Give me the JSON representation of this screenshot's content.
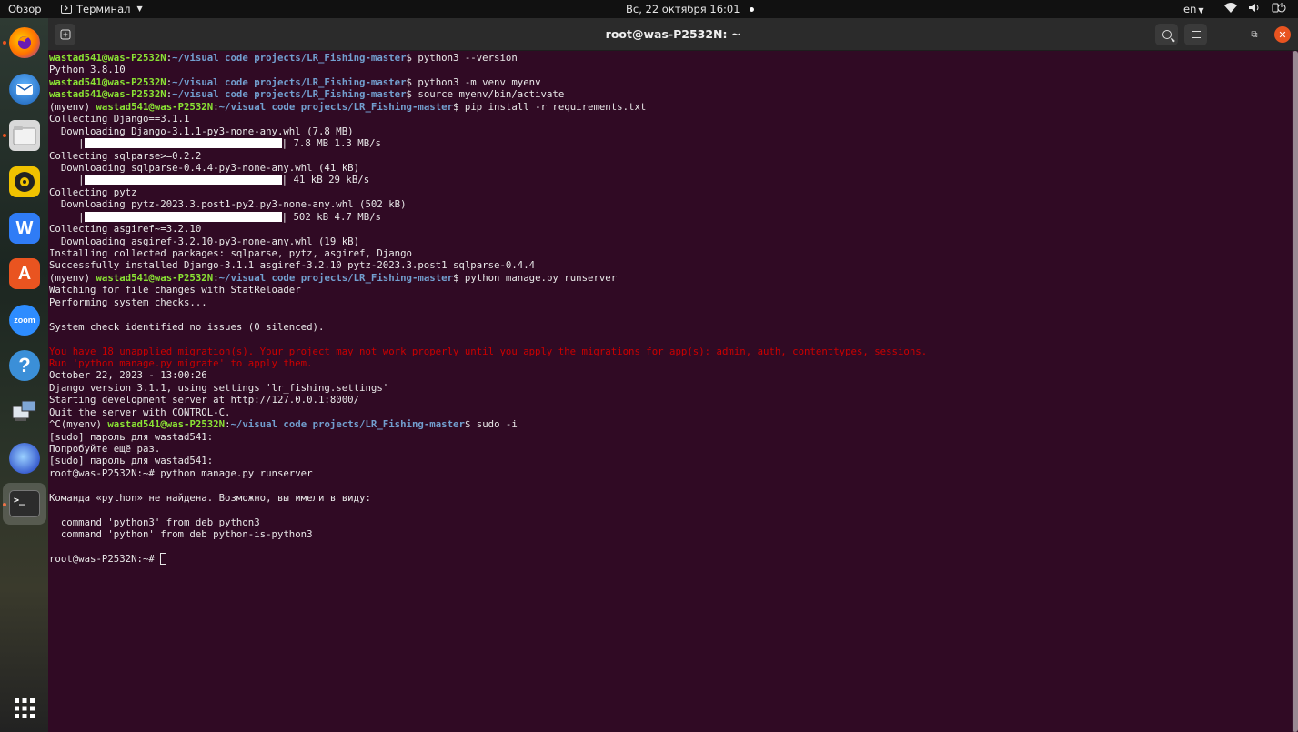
{
  "topbar": {
    "overview": "Обзор",
    "app_name": "Терминал",
    "clock": "Вс, 22 октября  16:01",
    "lang": "en"
  },
  "dock": {
    "items": [
      {
        "name": "firefox-icon",
        "glyph": "🦊",
        "color": "#e66000"
      },
      {
        "name": "thunderbird-icon",
        "glyph": "✉",
        "color": "#2a6bcb"
      },
      {
        "name": "files-icon",
        "glyph": "▭",
        "color": "#cfcfcf"
      },
      {
        "name": "rhythmbox-icon",
        "glyph": "◉",
        "color": "#f0c200"
      },
      {
        "name": "wps-writer-icon",
        "glyph": "W",
        "color": "#2f7cf6"
      },
      {
        "name": "app-center-icon",
        "glyph": "A",
        "color": "#e95420"
      },
      {
        "name": "zoom-icon",
        "glyph": "zoom",
        "color": "#2d8cff"
      },
      {
        "name": "help-icon",
        "glyph": "?",
        "color": "#3b8fd8"
      },
      {
        "name": "remote-desktop-icon",
        "glyph": "🖳",
        "color": "#4a7ab0"
      },
      {
        "name": "gnome-app-icon",
        "glyph": "◍",
        "color": "#4a6fd6"
      },
      {
        "name": "terminal-icon",
        "glyph": ">_",
        "color": "#3a3a3a"
      }
    ],
    "grid_label": "⋮⋮⋮"
  },
  "window": {
    "title": "root@was-P2532N: ~"
  },
  "terminal": {
    "user_host": "wastad541@was-P2532N",
    "path": "~/visual code projects/LR_Fishing-master",
    "venv": "(myenv) ",
    "lines": {
      "l1_cmd": "$ python3 --version",
      "l2": "Python 3.8.10",
      "l3_cmd": "$ python3 -m venv myenv",
      "l4_cmd": "$ source myenv/bin/activate",
      "l5_cmd": "$ pip install -r requirements.txt",
      "l6": "Collecting Django==3.1.1",
      "l7": "  Downloading Django-3.1.1-py3-none-any.whl (7.8 MB)",
      "l8_pre": "     |",
      "l8_post": "| 7.8 MB 1.3 MB/s",
      "l9": "Collecting sqlparse>=0.2.2",
      "l10": "  Downloading sqlparse-0.4.4-py3-none-any.whl (41 kB)",
      "l11_pre": "     |",
      "l11_post": "| 41 kB 29 kB/s",
      "l12": "Collecting pytz",
      "l13": "  Downloading pytz-2023.3.post1-py2.py3-none-any.whl (502 kB)",
      "l14_pre": "     |",
      "l14_post": "| 502 kB 4.7 MB/s",
      "l15": "Collecting asgiref~=3.2.10",
      "l16": "  Downloading asgiref-3.2.10-py3-none-any.whl (19 kB)",
      "l17": "Installing collected packages: sqlparse, pytz, asgiref, Django",
      "l18": "Successfully installed Django-3.1.1 asgiref-3.2.10 pytz-2023.3.post1 sqlparse-0.4.4",
      "l19_cmd": "$ python manage.py runserver",
      "l20": "Watching for file changes with StatReloader",
      "l21": "Performing system checks...",
      "l22": "",
      "l23": "System check identified no issues (0 silenced).",
      "l24": "",
      "l25": "You have 18 unapplied migration(s). Your project may not work properly until you apply the migrations for app(s): admin, auth, contenttypes, sessions.",
      "l26": "Run 'python manage.py migrate' to apply them.",
      "l27": "October 22, 2023 - 13:00:26",
      "l28": "Django version 3.1.1, using settings 'lr_fishing.settings'",
      "l29": "Starting development server at http://127.0.0.1:8000/",
      "l30": "Quit the server with CONTROL-C.",
      "l31_pre": "^C(myenv) ",
      "l31_cmd": "$ sudo -i",
      "l32": "[sudo] пароль для wastad541:",
      "l33": "Попробуйте ещё раз.",
      "l34": "[sudo] пароль для wastad541:",
      "l35": "root@was-P2532N:~# python manage.py runserver",
      "l36": "",
      "l37": "Команда «python» не найдена. Возможно, вы имели в виду:",
      "l38": "",
      "l39": "  command 'python3' from deb python3",
      "l40": "  command 'python' from deb python-is-python3",
      "l41": "",
      "l42": "root@was-P2532N:~# "
    }
  }
}
